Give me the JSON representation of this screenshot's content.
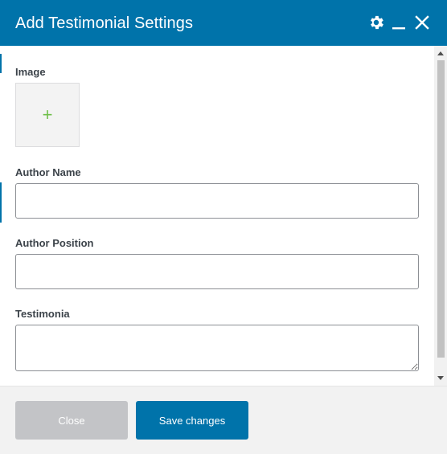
{
  "dialog": {
    "title": "Add Testimonial Settings",
    "icons": {
      "settings": "gear-icon",
      "minimize": "minimize-icon",
      "close": "close-icon"
    }
  },
  "form": {
    "image_label": "Image",
    "image_add_symbol": "+",
    "author_name_label": "Author Name",
    "author_name_value": "",
    "author_position_label": "Author Position",
    "author_position_value": "",
    "testimonial_label": "Testimonia",
    "testimonial_value": ""
  },
  "footer": {
    "close_label": "Close",
    "save_label": "Save changes"
  },
  "colors": {
    "header_bg": "#0073aa",
    "primary_button": "#0073aa",
    "disabled_button": "#c3c4c7",
    "add_image_plus": "#6fbf4a"
  }
}
